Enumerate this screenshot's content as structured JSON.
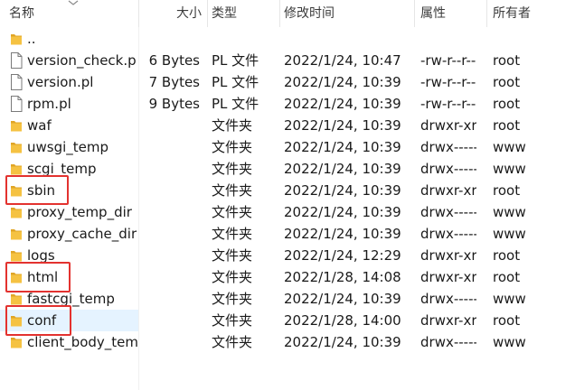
{
  "columns": {
    "name": "名称",
    "size": "大小",
    "type": "类型",
    "modified": "修改时间",
    "attributes": "属性",
    "owner": "所有者"
  },
  "rows": [
    {
      "name": "..",
      "size": "",
      "type": "",
      "modified": "",
      "attributes": "",
      "owner": "",
      "icon": "folder-icon"
    },
    {
      "name": "version_check.pl",
      "size": "6 Bytes",
      "type": "PL 文件",
      "modified": "2022/1/24, 10:47",
      "attributes": "-rw-r--r--",
      "owner": "root",
      "icon": "file-icon"
    },
    {
      "name": "version.pl",
      "size": "7 Bytes",
      "type": "PL 文件",
      "modified": "2022/1/24, 10:39",
      "attributes": "-rw-r--r--",
      "owner": "root",
      "icon": "file-icon"
    },
    {
      "name": "rpm.pl",
      "size": "9 Bytes",
      "type": "PL 文件",
      "modified": "2022/1/24, 10:39",
      "attributes": "-rw-r--r--",
      "owner": "root",
      "icon": "file-icon"
    },
    {
      "name": "waf",
      "size": "",
      "type": "文件夹",
      "modified": "2022/1/24, 10:39",
      "attributes": "drwxr-xr-x",
      "owner": "root",
      "icon": "folder-icon"
    },
    {
      "name": "uwsgi_temp",
      "size": "",
      "type": "文件夹",
      "modified": "2022/1/24, 10:39",
      "attributes": "drwx------",
      "owner": "www",
      "icon": "folder-icon"
    },
    {
      "name": "scgi_temp",
      "size": "",
      "type": "文件夹",
      "modified": "2022/1/24, 10:39",
      "attributes": "drwx------",
      "owner": "www",
      "icon": "folder-icon"
    },
    {
      "name": "sbin",
      "size": "",
      "type": "文件夹",
      "modified": "2022/1/24, 10:39",
      "attributes": "drwxr-xr-x",
      "owner": "root",
      "icon": "folder-icon"
    },
    {
      "name": "proxy_temp_dir",
      "size": "",
      "type": "文件夹",
      "modified": "2022/1/24, 10:39",
      "attributes": "drwx------",
      "owner": "www",
      "icon": "folder-icon"
    },
    {
      "name": "proxy_cache_dir",
      "size": "",
      "type": "文件夹",
      "modified": "2022/1/24, 10:39",
      "attributes": "drwx------",
      "owner": "www",
      "icon": "folder-icon"
    },
    {
      "name": "logs",
      "size": "",
      "type": "文件夹",
      "modified": "2022/1/24, 12:29",
      "attributes": "drwxr-xr-x",
      "owner": "root",
      "icon": "folder-icon"
    },
    {
      "name": "html",
      "size": "",
      "type": "文件夹",
      "modified": "2022/1/28, 14:08",
      "attributes": "drwxr-xr-x",
      "owner": "root",
      "icon": "folder-icon"
    },
    {
      "name": "fastcgi_temp",
      "size": "",
      "type": "文件夹",
      "modified": "2022/1/24, 10:39",
      "attributes": "drwx------",
      "owner": "www",
      "icon": "folder-icon"
    },
    {
      "name": "conf",
      "size": "",
      "type": "文件夹",
      "modified": "2022/1/28, 14:00",
      "attributes": "drwxr-xr-x",
      "owner": "root",
      "icon": "folder-icon"
    },
    {
      "name": "client_body_temp",
      "size": "",
      "type": "文件夹",
      "modified": "2022/1/24, 10:39",
      "attributes": "drwx------",
      "owner": "www",
      "icon": "folder-icon"
    }
  ],
  "selected_row": "conf",
  "highlighted_rows": [
    "sbin",
    "html",
    "conf"
  ],
  "colors": {
    "folder": "#f5c242",
    "folder_dark": "#e0a526",
    "selection": "#e5f3ff",
    "highlight_box": "#e3322f"
  }
}
